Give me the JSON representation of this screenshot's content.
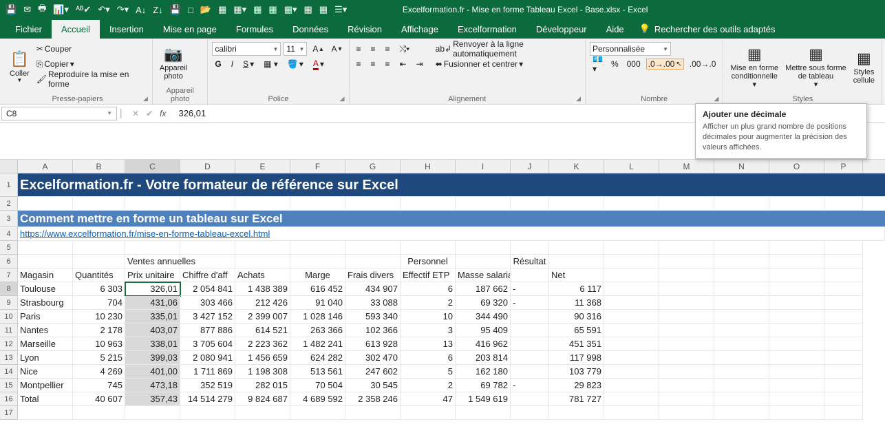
{
  "title": "Excelformation.fr - Mise en forme Tableau Excel - Base.xlsx - Excel",
  "tabs": {
    "file": "Fichier",
    "home": "Accueil",
    "insert": "Insertion",
    "layout": "Mise en page",
    "formulas": "Formules",
    "data": "Données",
    "review": "Révision",
    "view": "Affichage",
    "ef": "Excelformation",
    "dev": "Développeur",
    "help": "Aide"
  },
  "search_label": "Rechercher des outils adaptés",
  "groups": {
    "clipboard": {
      "label": "Presse-papiers",
      "paste": "Coller",
      "cut": "Couper",
      "copy": "Copier",
      "fmtpaint": "Reproduire la mise en forme"
    },
    "camera": {
      "label": "Appareil photo",
      "btn": "Appareil\nphoto"
    },
    "font": {
      "label": "Police",
      "name": "calibri",
      "size": "11",
      "bold": "G",
      "italic": "I",
      "underline": "S"
    },
    "align": {
      "label": "Alignement",
      "wrap": "Renvoyer à la ligne automatiquement",
      "merge": "Fusionner et centrer"
    },
    "number": {
      "label": "Nombre",
      "format": "Personnalisée"
    },
    "styles": {
      "label": "Styles",
      "condfmt": "Mise en forme\nconditionnelle",
      "fmttable": "Mettre sous forme\nde tableau",
      "cellstyles": "Styles\ncellule"
    }
  },
  "tooltip": {
    "title": "Ajouter une décimale",
    "body": "Afficher un plus grand nombre de positions décimales pour augmenter la précision des valeurs affichées."
  },
  "namebox": "C8",
  "formula": "326,01",
  "columns": [
    "A",
    "B",
    "C",
    "D",
    "E",
    "F",
    "G",
    "H",
    "I",
    "J",
    "K",
    "L",
    "M",
    "N",
    "O",
    "P"
  ],
  "banner": "Excelformation.fr - Votre formateur de référence sur Excel",
  "subtitle": "Comment mettre en forme un tableau sur Excel",
  "link": "https://www.excelformation.fr/mise-en-forme-tableau-excel.html",
  "sections": {
    "sales": "Ventes annuelles",
    "staff": "Personnel",
    "result": "Résultat"
  },
  "headers": {
    "store": "Magasin",
    "qty": "Quantités",
    "price": "Prix unitaire",
    "rev": "Chiffre d'aff",
    "pur": "Achats",
    "margin": "Marge",
    "misc": "Frais divers",
    "fte": "Effectif ETP",
    "payroll": "Masse salarial",
    "net": "Net"
  },
  "rows": [
    {
      "a": "Toulouse",
      "b": "6 303",
      "c": "326,01",
      "d": "2 054 841",
      "e": "1 438 389",
      "f": "616 452",
      "g": "434 907",
      "h": "6",
      "i": "187 662",
      "j": "-",
      "k": "6 117"
    },
    {
      "a": "Strasbourg",
      "b": "704",
      "c": "431,06",
      "d": "303 466",
      "e": "212 426",
      "f": "91 040",
      "g": "33 088",
      "h": "2",
      "i": "69 320",
      "j": "-",
      "k": "11 368"
    },
    {
      "a": "Paris",
      "b": "10 230",
      "c": "335,01",
      "d": "3 427 152",
      "e": "2 399 007",
      "f": "1 028 146",
      "g": "593 340",
      "h": "10",
      "i": "344 490",
      "j": "",
      "k": "90 316"
    },
    {
      "a": "Nantes",
      "b": "2 178",
      "c": "403,07",
      "d": "877 886",
      "e": "614 521",
      "f": "263 366",
      "g": "102 366",
      "h": "3",
      "i": "95 409",
      "j": "",
      "k": "65 591"
    },
    {
      "a": "Marseille",
      "b": "10 963",
      "c": "338,01",
      "d": "3 705 604",
      "e": "2 223 362",
      "f": "1 482 241",
      "g": "613 928",
      "h": "13",
      "i": "416 962",
      "j": "",
      "k": "451 351"
    },
    {
      "a": "Lyon",
      "b": "5 215",
      "c": "399,03",
      "d": "2 080 941",
      "e": "1 456 659",
      "f": "624 282",
      "g": "302 470",
      "h": "6",
      "i": "203 814",
      "j": "",
      "k": "117 998"
    },
    {
      "a": "Nice",
      "b": "4 269",
      "c": "401,00",
      "d": "1 711 869",
      "e": "1 198 308",
      "f": "513 561",
      "g": "247 602",
      "h": "5",
      "i": "162 180",
      "j": "",
      "k": "103 779"
    },
    {
      "a": "Montpellier",
      "b": "745",
      "c": "473,18",
      "d": "352 519",
      "e": "282 015",
      "f": "70 504",
      "g": "30 545",
      "h": "2",
      "i": "69 782",
      "j": "-",
      "k": "29 823"
    },
    {
      "a": "Total",
      "b": "40 607",
      "c": "357,43",
      "d": "14 514 279",
      "e": "9 824 687",
      "f": "4 689 592",
      "g": "2 358 246",
      "h": "47",
      "i": "1 549 619",
      "j": "",
      "k": "781 727"
    }
  ]
}
